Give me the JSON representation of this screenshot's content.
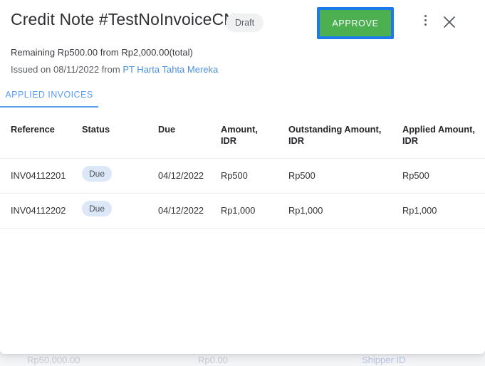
{
  "background": {
    "values": [
      "Rp50,000.00",
      "Rp0.00",
      "Shipper ID"
    ]
  },
  "header": {
    "title": "Credit Note #TestNoInvoiceCN",
    "status_badge": "Draft",
    "approve_label": "APPROVE",
    "approve_color": "#4caf50",
    "focus_ring_color": "#1c7aea",
    "more_icon": "kebab-menu-icon",
    "close_icon": "close-icon"
  },
  "summary": {
    "remaining_line": "Remaining Rp500.00 from Rp2,000.00(total)",
    "issued_prefix": "Issued on 08/11/2022 from ",
    "issuer_link": "PT Harta Tahta Mereka",
    "link_color": "#4a90e2"
  },
  "tabs": {
    "items": [
      {
        "label": "APPLIED INVOICES",
        "active": true
      }
    ],
    "accent_color": "#5a9cf8"
  },
  "table": {
    "columns": [
      "Reference",
      "Status",
      "Due",
      "Amount,\nIDR",
      "Outstanding Amount,\nIDR",
      "Applied Amount,\nIDR"
    ],
    "columns_split": [
      {
        "line1": "Reference",
        "line2": ""
      },
      {
        "line1": "Status",
        "line2": ""
      },
      {
        "line1": "Due",
        "line2": ""
      },
      {
        "line1": "Amount,",
        "line2": "IDR"
      },
      {
        "line1": "Outstanding Amount,",
        "line2": "IDR"
      },
      {
        "line1": "Applied Amount,",
        "line2": "IDR"
      }
    ],
    "rows": [
      {
        "reference": "INV04112201",
        "status": "Due",
        "due": "04/12/2022",
        "amount": "Rp500",
        "outstanding": "Rp500",
        "applied": "Rp500"
      },
      {
        "reference": "INV04112202",
        "status": "Due",
        "due": "04/12/2022",
        "amount": "Rp1,000",
        "outstanding": "Rp1,000",
        "applied": "Rp1,000"
      }
    ],
    "status_badge_bg": "#dce8f7"
  }
}
